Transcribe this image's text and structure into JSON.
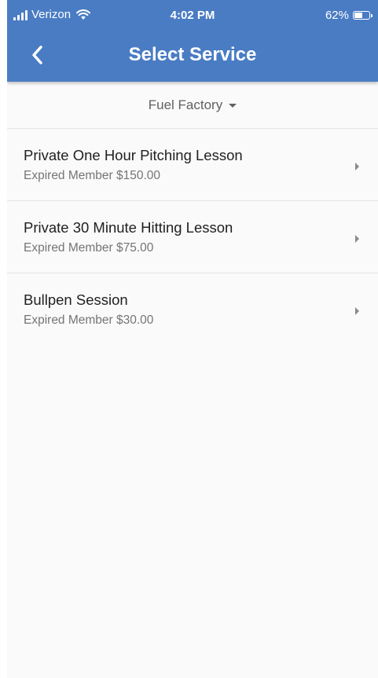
{
  "status_bar": {
    "carrier": "Verizon",
    "time": "4:02 PM",
    "battery": "62%",
    "battery_level": 0.62,
    "icons": [
      "signal-icon",
      "wifi-icon",
      "battery-icon"
    ]
  },
  "header": {
    "title": "Select Service",
    "back_icon": "chevron-left-icon",
    "background_color": "#4a7cc4"
  },
  "location": {
    "label": "Fuel Factory",
    "icon": "caret-down-icon"
  },
  "services": [
    {
      "name": "Private One Hour Pitching Lesson",
      "price": "Expired Member $150.00"
    },
    {
      "name": "Private 30 Minute Hitting Lesson",
      "price": "Expired Member $75.00"
    },
    {
      "name": "Bullpen Session",
      "price": "Expired Member $30.00"
    }
  ]
}
